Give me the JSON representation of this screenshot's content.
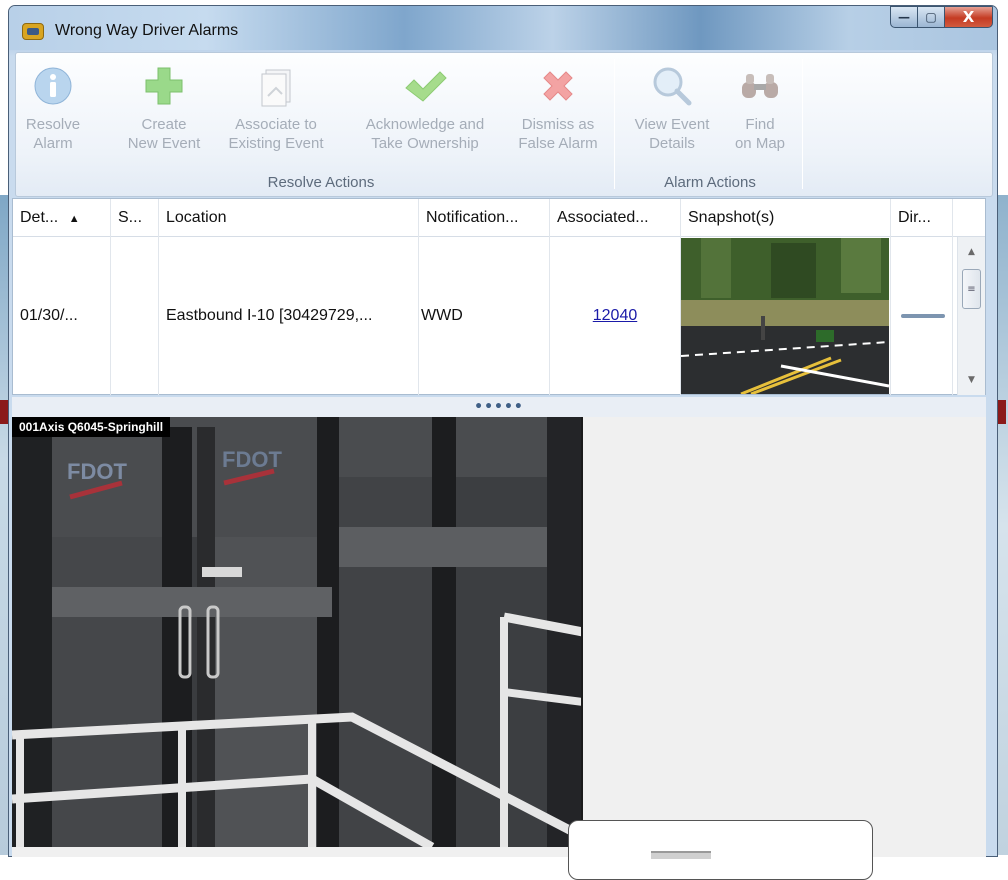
{
  "window": {
    "title": "Wrong Way Driver Alarms",
    "controls": {
      "minimize": "—",
      "maximize": "▢",
      "close": "X"
    }
  },
  "ribbon": {
    "groups": [
      {
        "label": "Resolve Actions",
        "buttons": [
          {
            "line1": "Resolve",
            "line2": "Alarm",
            "icon": "info-icon"
          },
          {
            "line1": "Create",
            "line2": "New Event",
            "icon": "plus-icon"
          },
          {
            "line1": "Associate to",
            "line2": "Existing Event",
            "icon": "document-icon"
          },
          {
            "line1": "Acknowledge and",
            "line2": "Take Ownership",
            "icon": "checkmark-icon"
          },
          {
            "line1": "Dismiss as",
            "line2": "False Alarm",
            "icon": "x-icon"
          }
        ]
      },
      {
        "label": "Alarm Actions",
        "buttons": [
          {
            "line1": "View Event",
            "line2": "Details",
            "icon": "magnifier-icon"
          },
          {
            "line1": "Find",
            "line2": "on Map",
            "icon": "binoculars-icon"
          }
        ]
      }
    ]
  },
  "grid": {
    "columns": [
      "Det...",
      "S...",
      "Location",
      "Notification...",
      "Associated...",
      "Snapshot(s)",
      "Dir..."
    ],
    "sort_indicator": "▲",
    "rows": [
      {
        "detected": "01/30/...",
        "status": "",
        "location": "Eastbound I-10 [30429729,...",
        "notification": "WWD",
        "associated": "12040"
      }
    ]
  },
  "splitter": {
    "grip": "•••••"
  },
  "video": {
    "camera_label": "001Axis Q6045-Springhill"
  }
}
